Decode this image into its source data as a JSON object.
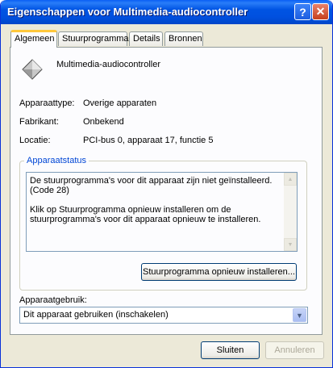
{
  "window": {
    "title": "Eigenschappen voor Multimedia-audiocontroller",
    "help_label": "?",
    "close_label": "✕"
  },
  "tabs": [
    {
      "label": "Algemeen",
      "active": true
    },
    {
      "label": "Stuurprogramma",
      "active": false
    },
    {
      "label": "Details",
      "active": false
    },
    {
      "label": "Bronnen",
      "active": false
    }
  ],
  "device": {
    "icon": "generic-device-icon",
    "name": "Multimedia-audiocontroller",
    "type_label": "Apparaattype:",
    "type_value": "Overige apparaten",
    "manufacturer_label": "Fabrikant:",
    "manufacturer_value": "Onbekend",
    "location_label": "Locatie:",
    "location_value": "PCI-bus 0, apparaat 17, functie 5"
  },
  "status": {
    "group_title": "Apparaatstatus",
    "text": "De stuurprogramma's voor dit apparaat zijn niet geïnstalleerd.\n(Code 28)\n\nKlik op Stuurprogramma opnieuw installeren om de\nstuurprogramma's voor dit apparaat opnieuw te installeren.",
    "reinstall_button": "Stuurprogramma opnieuw installeren..."
  },
  "usage": {
    "label": "Apparaatgebruik:",
    "selected": "Dit apparaat gebruiken (inschakelen)"
  },
  "footer": {
    "ok_label": "Sluiten",
    "cancel_label": "Annuleren"
  },
  "colors": {
    "titlebar": "#0054e3",
    "accent_tab": "#ffc83c",
    "group_title": "#0046d5",
    "panel": "#fcfcfe",
    "dialog": "#ece9d8"
  }
}
